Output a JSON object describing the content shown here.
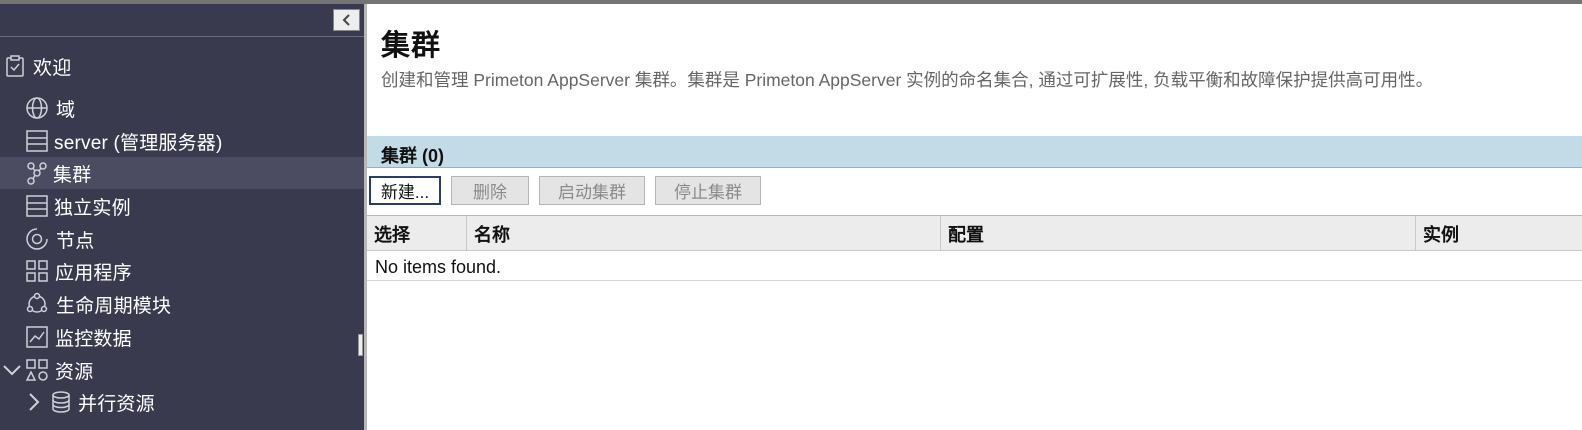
{
  "sidebar": {
    "items": [
      {
        "label": "欢迎",
        "icon": "clipboard-check-icon"
      },
      {
        "label": "域",
        "icon": "globe-icon"
      },
      {
        "label": "server (管理服务器)",
        "icon": "server-icon"
      },
      {
        "label": "集群",
        "icon": "cluster-icon",
        "active": true
      },
      {
        "label": "独立实例",
        "icon": "server-icon"
      },
      {
        "label": "节点",
        "icon": "node-icon"
      },
      {
        "label": "应用程序",
        "icon": "apps-grid-icon"
      },
      {
        "label": "生命周期模块",
        "icon": "lifecycle-icon"
      },
      {
        "label": "监控数据",
        "icon": "chart-icon"
      },
      {
        "label": "资源",
        "icon": "resources-icon",
        "expanded": true
      },
      {
        "label": "并行资源",
        "icon": "database-icon",
        "expanded": false
      }
    ]
  },
  "main": {
    "title": "集群",
    "description": "创建和管理 Primeton AppServer 集群。集群是 Primeton AppServer 实例的命名集合, 通过可扩展性, 负载平衡和故障保护提供高可用性。",
    "section_title": "集群 (0)",
    "toolbar": {
      "new_label": "新建...",
      "delete_label": "删除",
      "start_label": "启动集群",
      "stop_label": "停止集群"
    },
    "table": {
      "columns": [
        "选择",
        "名称",
        "配置",
        "实例"
      ],
      "empty_text": "No items found."
    }
  },
  "colors": {
    "sidebar_bg": "#3a3a4e",
    "sidebar_active_bg": "#4b4b61",
    "section_header_bg": "#c3dbe6",
    "table_header_bg": "#ececec"
  }
}
